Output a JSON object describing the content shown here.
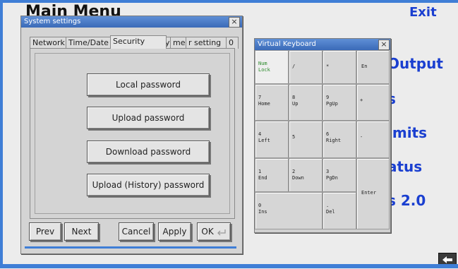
{
  "main": {
    "title": "Main Menu",
    "exit_label": "Exit",
    "items": [
      "Output",
      "s",
      "imits",
      "atus",
      "s 2.0"
    ]
  },
  "dialog": {
    "title": "System settings",
    "close_glyph": "×",
    "tabs": [
      "Network",
      "Time/Date",
      "Security",
      "y",
      "me",
      "r setting",
      "0"
    ],
    "password_buttons": [
      "Local password",
      "Upload password",
      "Download password",
      "Upload (History) password"
    ],
    "footer": {
      "prev": "Prev",
      "next": "Next",
      "cancel": "Cancel",
      "apply": "Apply",
      "ok": "OK"
    }
  },
  "keyboard": {
    "title": "Virtual Keyboard",
    "close_glyph": "×",
    "keys": [
      {
        "name": "key-num-lock",
        "label": "Num\nLock"
      },
      {
        "name": "key-slash",
        "label": "/"
      },
      {
        "name": "key-asterisk",
        "label": "*"
      },
      {
        "name": "key-en",
        "label": "En"
      },
      {
        "name": "key-7",
        "label": "7\nHome"
      },
      {
        "name": "key-8",
        "label": "8\nUp"
      },
      {
        "name": "key-9",
        "label": "9\nPgUp"
      },
      {
        "name": "key-plus",
        "label": "+"
      },
      {
        "name": "key-4",
        "label": "4\nLeft"
      },
      {
        "name": "key-5",
        "label": "5"
      },
      {
        "name": "key-6",
        "label": "6\nRight"
      },
      {
        "name": "key-minus",
        "label": "-"
      },
      {
        "name": "key-1",
        "label": "1\nEnd"
      },
      {
        "name": "key-2",
        "label": "2\nDown"
      },
      {
        "name": "key-3",
        "label": "3\nPgDn"
      },
      {
        "name": "key-enter",
        "label": "Enter"
      },
      {
        "name": "key-0",
        "label": "0\nIns"
      },
      {
        "name": "key-del",
        "label": ".\nDel"
      }
    ]
  },
  "colors": {
    "accent": "#3f7ed6",
    "menu_text": "#1a3fd0",
    "numlock_text": "#2a8a2a"
  }
}
